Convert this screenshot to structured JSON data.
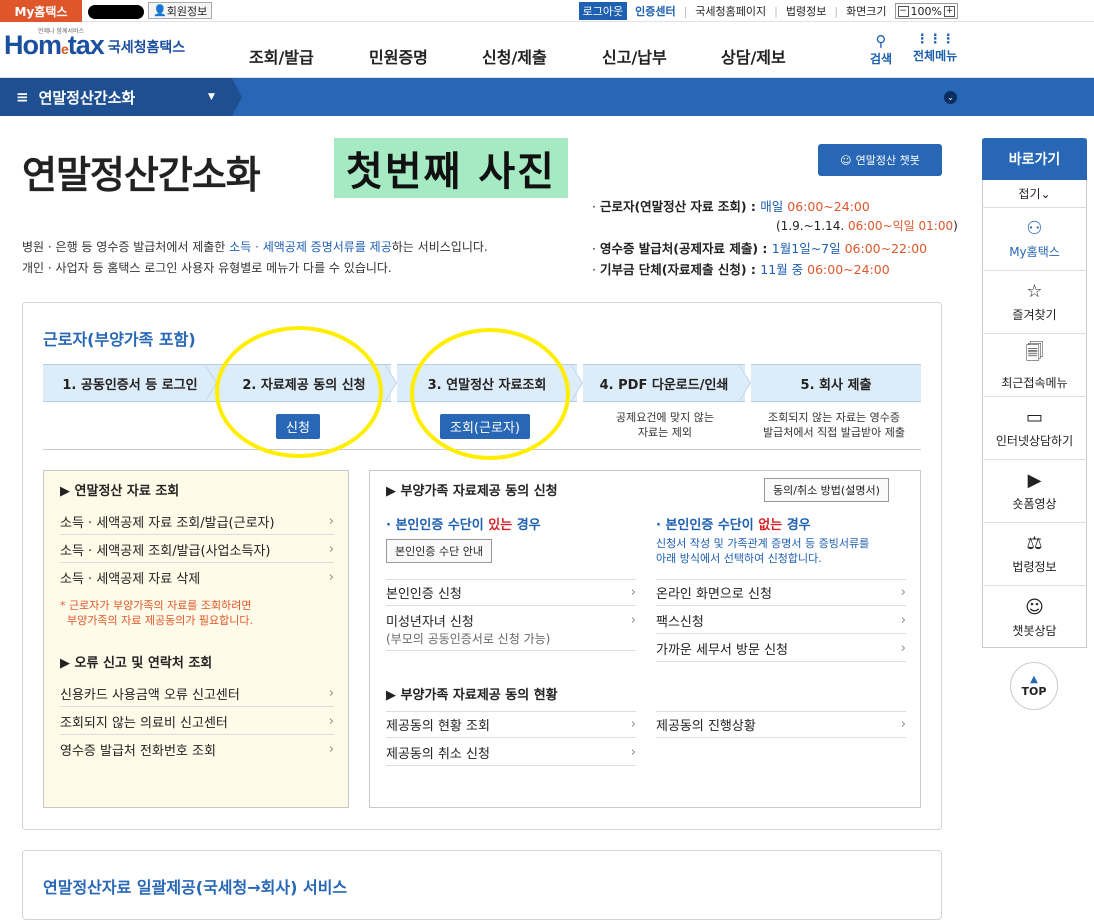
{
  "topbar": {
    "myhome": "My홈택스",
    "member_info": "회원정보",
    "logout": "로그아웃",
    "auth_center": "인증센터",
    "links": [
      "국세청홈페이지",
      "법령정보",
      "화면크기"
    ],
    "zoom": "100%"
  },
  "header": {
    "logo_home": "Hom",
    "logo_e": "e",
    "logo_tax": "tax",
    "logo_kr": "국세청홈택스",
    "logo_tag": "언제나 함께서비스",
    "gnb": [
      "조회/발급",
      "민원증명",
      "신청/제출",
      "신고/납부",
      "상담/제보"
    ],
    "search": "검색",
    "all_menu": "전체메뉴"
  },
  "nav": {
    "current": "연말정산간소화"
  },
  "page": {
    "title": "연말정산간소화",
    "photo_label": "첫번째 사진",
    "chatbot": "연말정산 챗봇",
    "desc1_pre": "병원 · 은행 등 영수증 발급처에서 제출한 ",
    "desc1_link": "소득 · 세액공제 증명서류를 제공",
    "desc1_post": "하는 서비스입니다.",
    "desc2": "개인 · 사업자 등 홈택스 로그인 사용자 유형별로 메뉴가 다를 수 있습니다."
  },
  "schedule": [
    {
      "label": "근로자(연말정산 자료 조회) : ",
      "a": "매일 ",
      "b": "06:00~24:00"
    },
    {
      "label": "",
      "a": "(1.9.~1.14. ",
      "b": "06:00~익일 01:00",
      "c": ")"
    },
    {
      "label": "영수증 발급처(공제자료 제출) : ",
      "a": "1월1일~7일 ",
      "b": "06:00~22:00"
    },
    {
      "label": "기부금 단체(자료제출 신청) : ",
      "a": "11월 중 ",
      "b": "06:00~24:00"
    }
  ],
  "section1": {
    "title": "근로자(부양가족 포함)",
    "steps": [
      "1. 공동인증서 등 로그인",
      "2. 자료제공 동의 신청",
      "3. 연말정산 자료조회",
      "4. PDF 다운로드/인쇄",
      "5. 회사 제출"
    ],
    "step2_btn": "신청",
    "step3_btn": "조회(근로자)",
    "step4_note": "공제요건에 맞지 않는\n자료는 제외",
    "step5_note": "조회되지 않는 자료는 영수증\n발급처에서 직접 발급받아 제출"
  },
  "left": {
    "h1": "연말정산 자료 조회",
    "links1": [
      "소득 · 세액공제 자료 조회/발급(근로자)",
      "소득 · 세액공제 조회/발급(사업소득자)",
      "소득 · 세액공제 자료 삭제"
    ],
    "note1": "* 근로자가 부양가족의 자료를 조회하려면",
    "note2": "부양가족의 자료 제공동의가 필요합니다.",
    "h2": "오류 신고 및 연락처 조회",
    "links2": [
      "신용카드 사용금액 오류 신고센터",
      "조회되지 않는 의료비 신고센터",
      "영수증 발급처 전화번호 조회"
    ]
  },
  "right": {
    "h1": "부양가족 자료제공 동의 신청",
    "guide_btn": "동의/취소 방법(설명서)",
    "case1_pre": "본인인증 수단이 ",
    "case1_r": "있는",
    "case1_post": " 경우",
    "case1_btn": "본인인증 수단 안내",
    "case2_pre": "본인인증 수단이 ",
    "case2_r": "없는",
    "case2_post": " 경우",
    "case2_note1": "신청서 작성 및 가족관계 증명서 등 증빙서류를",
    "case2_note2": "아래 방식에서 선택하여 신청합니다.",
    "links_a": [
      "본인인증 신청",
      "미성년자녀 신청"
    ],
    "minor_note": "(부모의 공동인증서로 신청 가능)",
    "links_b": [
      "온라인 화면으로 신청",
      "팩스신청",
      "가까운 세무서 방문 신청"
    ],
    "h2": "부양가족 자료제공 동의 현황",
    "links_c": [
      "제공동의 현황 조회",
      "제공동의 취소 신청"
    ],
    "links_d": [
      "제공동의 진행상황"
    ]
  },
  "section2": {
    "title": "연말정산자료 일괄제공(국세청→회사) 서비스"
  },
  "quick": {
    "title": "바로가기",
    "fold": "접기",
    "items": [
      {
        "label": "My홈택스",
        "icon": "person-icon"
      },
      {
        "label": "즐겨찾기",
        "icon": "star-icon"
      },
      {
        "label": "최근접속메뉴",
        "icon": "recent-icon"
      },
      {
        "label": "인터넷상담하기",
        "icon": "chat-icon"
      },
      {
        "label": "숏폼영상",
        "icon": "play-icon"
      },
      {
        "label": "법령정보",
        "icon": "gavel-icon"
      },
      {
        "label": "챗봇상담",
        "icon": "bot-icon"
      }
    ],
    "top": "TOP"
  },
  "colors": {
    "brand_blue": "#2767b6",
    "nav_dark": "#1e4f91",
    "orange": "#e0562b",
    "highlight": "#a6eac3",
    "ring": "#ffee00"
  }
}
